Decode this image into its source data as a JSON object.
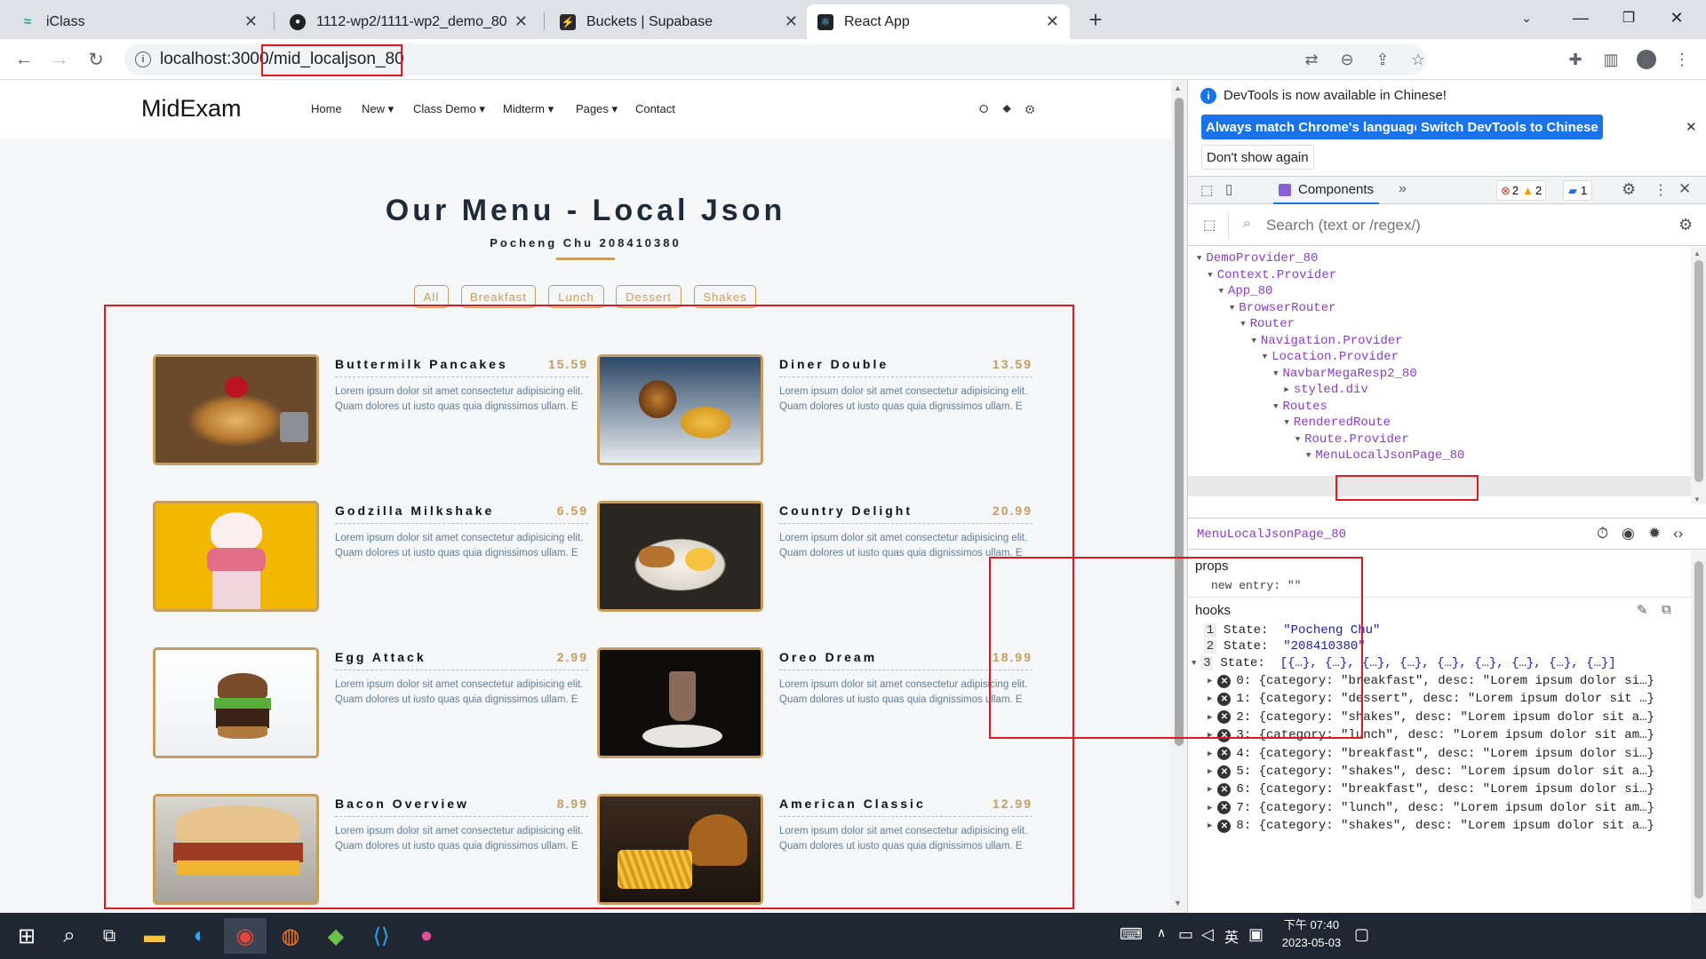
{
  "browser": {
    "tabs": [
      {
        "title": "iClass",
        "icon": "iclass-icon"
      },
      {
        "title": "1112-wp2/1111-wp2_demo_80",
        "icon": "github-icon"
      },
      {
        "title": "Buckets | Supabase",
        "icon": "supabase-icon"
      },
      {
        "title": "React App",
        "icon": "react-icon"
      }
    ],
    "url_host": "localhost:3000",
    "url_path": "/mid_localjson_80"
  },
  "site": {
    "brand": "MidExam",
    "nav": [
      "Home",
      "New",
      "Class Demo",
      "Midterm",
      "Pages",
      "Contact"
    ],
    "nav_icons": "⭘ ◆ ⚙"
  },
  "menu": {
    "title": "Our Menu - Local Json",
    "subtitle": "Pocheng Chu 208410380",
    "filters": [
      "All",
      "Breakfast",
      "Lunch",
      "Dessert",
      "Shakes"
    ],
    "desc": "Lorem ipsum dolor sit amet consectetur adipisicing elit. Quam dolores ut iusto quas quia dignissimos ullam. E",
    "items": [
      {
        "name": "Buttermilk Pancakes",
        "price": "15.59"
      },
      {
        "name": "Diner Double",
        "price": "13.59"
      },
      {
        "name": "Godzilla Milkshake",
        "price": "6.59"
      },
      {
        "name": "Country Delight",
        "price": "20.99"
      },
      {
        "name": "Egg Attack",
        "price": "2.99"
      },
      {
        "name": "Oreo Dream",
        "price": "18.99"
      },
      {
        "name": "Bacon Overview",
        "price": "8.99"
      },
      {
        "name": "American Classic",
        "price": "12.99"
      }
    ]
  },
  "devtools": {
    "banner": "DevTools is now available in Chinese!",
    "btn_match": "Always match Chrome's language",
    "btn_switch": "Switch DevTools to Chinese",
    "btn_dont": "Don't show again",
    "tab_components": "Components",
    "badge_errors": "2",
    "badge_warnings": "2",
    "badge_messages": "1",
    "search_placeholder": "Search (text or /regex/)",
    "tree": [
      {
        "label": "DemoProvider_80",
        "depth": 0
      },
      {
        "label": "Context.Provider",
        "depth": 1
      },
      {
        "label": "App_80",
        "depth": 2
      },
      {
        "label": "BrowserRouter",
        "depth": 3
      },
      {
        "label": "Router",
        "depth": 4
      },
      {
        "label": "Navigation.Provider",
        "depth": 5
      },
      {
        "label": "Location.Provider",
        "depth": 6
      },
      {
        "label": "NavbarMegaResp2_80",
        "depth": 7
      },
      {
        "label": "styled.div",
        "depth": 8
      },
      {
        "label": "Routes",
        "depth": 7
      },
      {
        "label": "RenderedRoute",
        "depth": 8
      },
      {
        "label": "Route.Provider",
        "depth": 9
      },
      {
        "label": "MenuLocalJsonPage_80",
        "depth": 10
      }
    ],
    "selected": "MenuLocalJsonPage_80",
    "props_label": "props",
    "props_key": "new entry:",
    "props_val": "\"\"",
    "hooks_label": "hooks",
    "hooks": [
      {
        "n": "1",
        "text": "State:",
        "val": "\"Pocheng Chu\""
      },
      {
        "n": "2",
        "text": "State:",
        "val": "\"208410380\""
      },
      {
        "n": "3",
        "text": "State:",
        "val": "[{…}, {…}, {…}, {…}, {…}, {…}, {…}, {…}, {…}]"
      }
    ],
    "state_items": [
      "0: {category: \"breakfast\", desc: \"Lorem ipsum dolor si…}",
      "1: {category: \"dessert\", desc: \"Lorem ipsum dolor sit …}",
      "2: {category: \"shakes\", desc: \"Lorem ipsum dolor sit a…}",
      "3: {category: \"lunch\", desc: \"Lorem ipsum dolor sit am…}",
      "4: {category: \"breakfast\", desc: \"Lorem ipsum dolor si…}",
      "5: {category: \"shakes\", desc: \"Lorem ipsum dolor sit a…}",
      "6: {category: \"breakfast\", desc: \"Lorem ipsum dolor si…}",
      "7: {category: \"lunch\", desc: \"Lorem ipsum dolor sit am…}",
      "8: {category: \"shakes\", desc: \"Lorem ipsum dolor sit a…}"
    ]
  },
  "taskbar": {
    "ime": "英",
    "time": "下午 07:40",
    "date": "2023-05-03"
  }
}
